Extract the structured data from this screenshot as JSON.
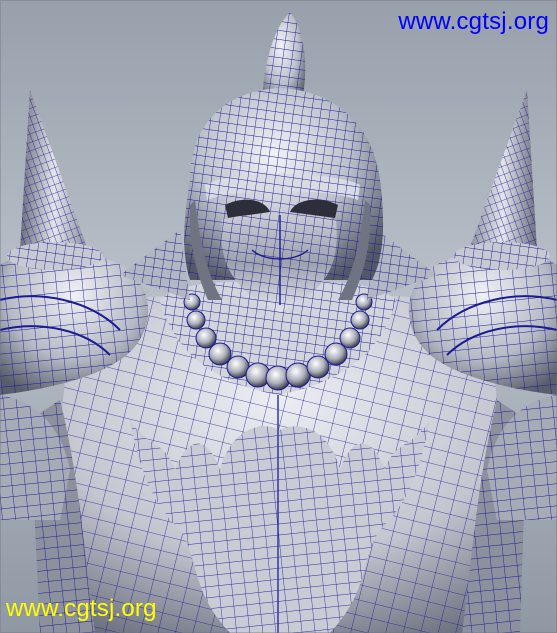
{
  "image": {
    "subject": "wireframe-armored-warrior-render",
    "colors": {
      "background_top": "#97a0ab",
      "background_bottom": "#8f98a3",
      "wire": "#1a1a8c",
      "surface_light": "#e6e8ee",
      "surface_mid": "#b9bcc6",
      "surface_dark": "#5c6070"
    }
  },
  "watermarks": {
    "top_text": "www.cgtsj.org",
    "top_color": "#0000ff",
    "bottom_text": "www.cgtsj.org",
    "bottom_color": "#ffff00"
  }
}
